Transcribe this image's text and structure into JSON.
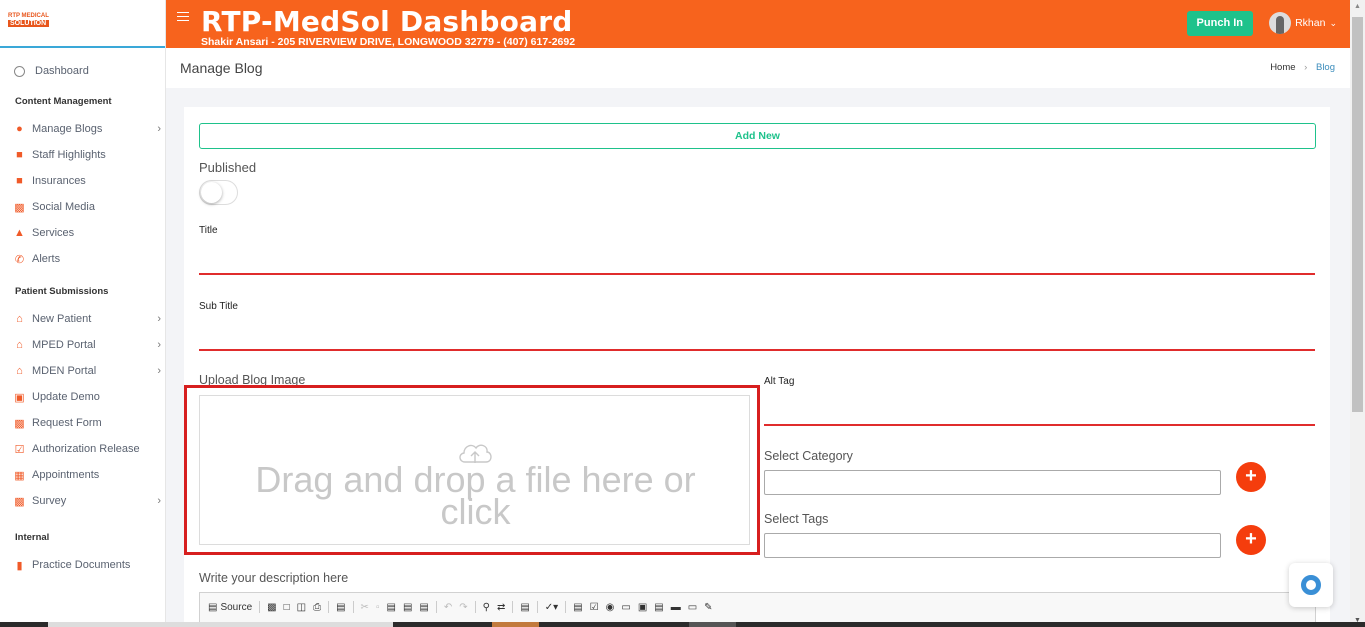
{
  "logo": {
    "line1": "RTP MEDICAL",
    "line2": "SOLUTION"
  },
  "header": {
    "title": "RTP-MedSol Dashboard",
    "subtitle": "Shakir Ansari - 205 RIVERVIEW DRIVE, LONGWOOD 32779 - (407) 617-2692",
    "punch_label": "Punch In",
    "user_name": "Rkhan"
  },
  "sidebar": {
    "dashboard": "Dashboard",
    "sections": {
      "content": "Content Management",
      "patient": "Patient Submissions",
      "internal": "Internal"
    },
    "content_items": [
      {
        "label": "Manage Blogs",
        "icon": "blog-icon"
      },
      {
        "label": "Staff Highlights",
        "icon": "staff-icon"
      },
      {
        "label": "Insurances",
        "icon": "insurance-icon"
      },
      {
        "label": "Social Media",
        "icon": "social-media-icon"
      },
      {
        "label": "Services",
        "icon": "services-icon"
      },
      {
        "label": "Alerts",
        "icon": "phone-icon"
      }
    ],
    "patient_items": [
      {
        "label": "New Patient",
        "icon": "home-icon"
      },
      {
        "label": "MPED Portal",
        "icon": "home-icon"
      },
      {
        "label": "MDEN Portal",
        "icon": "home-icon"
      },
      {
        "label": "Update Demo",
        "icon": "id-card-icon"
      },
      {
        "label": "Request Form",
        "icon": "form-icon"
      },
      {
        "label": "Authorization Release",
        "icon": "auth-icon"
      },
      {
        "label": "Appointments",
        "icon": "calendar-icon"
      },
      {
        "label": "Survey",
        "icon": "chart-icon"
      }
    ],
    "internal_items": [
      {
        "label": "Practice Documents",
        "icon": "document-icon"
      }
    ]
  },
  "page": {
    "title": "Manage Blog",
    "breadcrumb_home": "Home",
    "breadcrumb_current": "Blog"
  },
  "form": {
    "add_new": "Add New",
    "published_label": "Published",
    "title_label": "Title",
    "subtitle_label": "Sub Title",
    "upload_label": "Upload Blog Image",
    "drop_message": "Drag and drop a file here or click",
    "alt_tag_label": "Alt Tag",
    "category_label": "Select Category",
    "tags_label": "Select Tags",
    "description_label": "Write your description here",
    "source_label": "Source"
  },
  "colors": {
    "header": "#f7631d",
    "accent_green": "#1ec28b",
    "error_red": "#e02c2c",
    "plus_button": "#f53d0d",
    "link_blue": "#3c8dbc"
  }
}
